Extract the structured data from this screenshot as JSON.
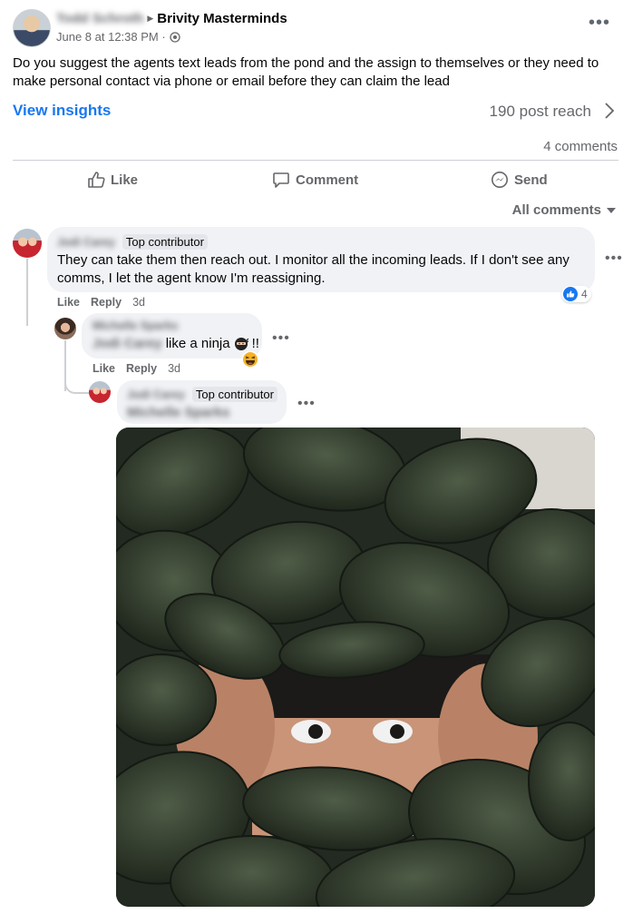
{
  "post": {
    "author": "Todd Schroth",
    "group": "Brivity Masterminds",
    "date": "June 8 at 12:38 PM ·",
    "text": "Do you suggest the agents text leads from the pond and the assign to themselves or they need to make personal contact via phone or email before they can claim the lead",
    "insights_label": "View insights",
    "reach": "190 post reach",
    "comments_count": "4 comments"
  },
  "actions": {
    "like": "Like",
    "comment": "Comment",
    "send": "Send"
  },
  "filter": {
    "label": "All comments"
  },
  "comments": [
    {
      "author": "Jodi Carey",
      "badge": "Top contributor",
      "text": "They can take them then reach out. I monitor all the incoming leads. If I don't see any comms, I let the agent know I'm reassigning.",
      "like": "Like",
      "reply": "Reply",
      "time": "3d",
      "reactions": "4"
    },
    {
      "author": "Michelle Sparks",
      "mention": "Jodi Carey",
      "text": "like a ninja",
      "suffix": "!!",
      "like": "Like",
      "reply": "Reply",
      "time": "3d"
    },
    {
      "author": "Jodi Carey",
      "badge": "Top contributor",
      "mention": "Michelle Sparks"
    }
  ],
  "colors": {
    "link_blue": "#1877f2",
    "muted": "#65676b",
    "bubble": "#f0f2f5"
  }
}
